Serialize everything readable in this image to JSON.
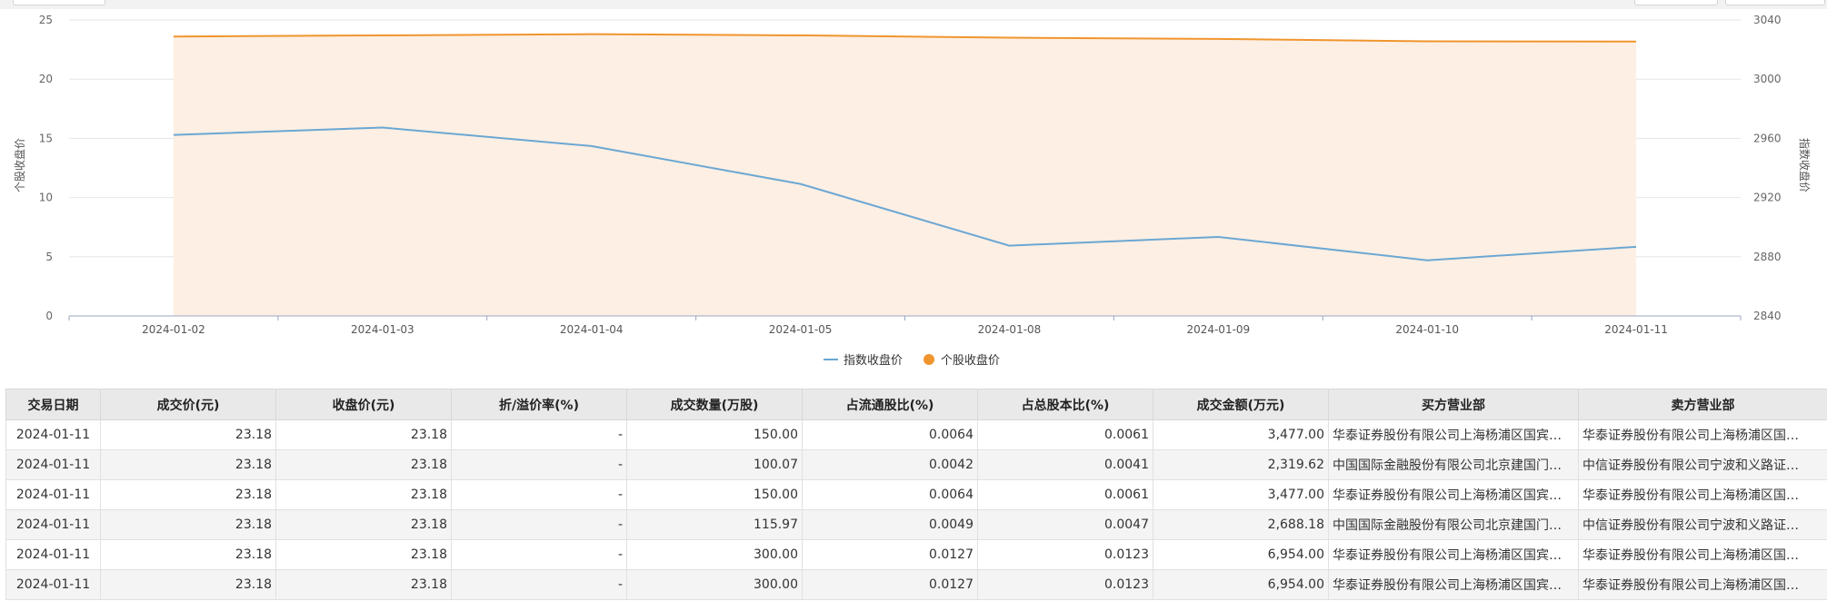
{
  "chart_data": {
    "type": "line+area",
    "categories": [
      "2024-01-02",
      "2024-01-03",
      "2024-01-04",
      "2024-01-05",
      "2024-01-08",
      "2024-01-09",
      "2024-01-10",
      "2024-01-11"
    ],
    "left_axis": {
      "label": "个股收盘价",
      "ticks": [
        0,
        5,
        10,
        15,
        20,
        25
      ],
      "ylim": [
        0,
        25
      ]
    },
    "right_axis": {
      "label": "指数收盘价",
      "ticks": [
        2840,
        2880,
        2920,
        2960,
        3000,
        3040
      ],
      "ylim": [
        2840,
        3040
      ]
    },
    "series": [
      {
        "name": "指数收盘价",
        "axis": "right",
        "style": "line",
        "color": "#6ba7d3",
        "values": [
          2962.3,
          2967.3,
          2954.8,
          2929.2,
          2887.5,
          2893.4,
          2877.6,
          2886.7
        ]
      },
      {
        "name": "个股收盘价",
        "axis": "left",
        "style": "area",
        "color": "#f0952e",
        "fill": "#fdefe4",
        "values": [
          23.6,
          23.7,
          23.8,
          23.7,
          23.5,
          23.4,
          23.2,
          23.18
        ]
      }
    ],
    "legend": {
      "position": "bottom-center"
    },
    "grid": true
  },
  "table": {
    "columns": [
      "交易日期",
      "成交价(元)",
      "收盘价(元)",
      "折/溢价率(%)",
      "成交数量(万股)",
      "占流通股比(%)",
      "占总股本比(%)",
      "成交金额(万元)",
      "买方营业部",
      "卖方营业部"
    ],
    "rows": [
      [
        "2024-01-11",
        "23.18",
        "23.18",
        "-",
        "150.00",
        "0.0064",
        "0.0061",
        "3,477.00",
        "华泰证券股份有限公司上海杨浦区国宾…",
        "华泰证券股份有限公司上海杨浦区国…"
      ],
      [
        "2024-01-11",
        "23.18",
        "23.18",
        "-",
        "100.07",
        "0.0042",
        "0.0041",
        "2,319.62",
        "中国国际金融股份有限公司北京建国门…",
        "中信证券股份有限公司宁波和义路证…"
      ],
      [
        "2024-01-11",
        "23.18",
        "23.18",
        "-",
        "150.00",
        "0.0064",
        "0.0061",
        "3,477.00",
        "华泰证券股份有限公司上海杨浦区国宾…",
        "华泰证券股份有限公司上海杨浦区国…"
      ],
      [
        "2024-01-11",
        "23.18",
        "23.18",
        "-",
        "115.97",
        "0.0049",
        "0.0047",
        "2,688.18",
        "中国国际金融股份有限公司北京建国门…",
        "中信证券股份有限公司宁波和义路证…"
      ],
      [
        "2024-01-11",
        "23.18",
        "23.18",
        "-",
        "300.00",
        "0.0127",
        "0.0123",
        "6,954.00",
        "华泰证券股份有限公司上海杨浦区国宾…",
        "华泰证券股份有限公司上海杨浦区国…"
      ],
      [
        "2024-01-11",
        "23.18",
        "23.18",
        "-",
        "300.00",
        "0.0127",
        "0.0123",
        "6,954.00",
        "华泰证券股份有限公司上海杨浦区国宾…",
        "华泰证券股份有限公司上海杨浦区国…"
      ]
    ]
  }
}
